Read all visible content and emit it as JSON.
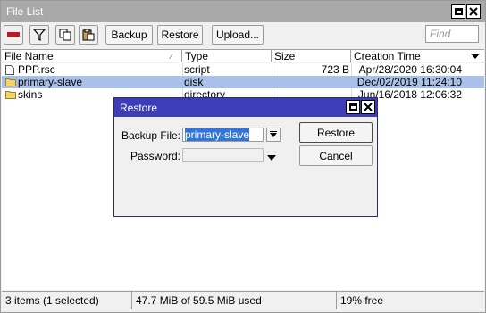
{
  "window": {
    "title": "File List"
  },
  "toolbar": {
    "backup_label": "Backup",
    "restore_label": "Restore",
    "upload_label": "Upload...",
    "find_placeholder": "Find"
  },
  "table": {
    "columns": [
      "File Name",
      "Type",
      "Size",
      "Creation Time"
    ],
    "rows": [
      {
        "name": "PPP.rsc",
        "type": "script",
        "size": "723 B",
        "time": "Apr/28/2020 16:30:04",
        "icon": "file-icon"
      },
      {
        "name": "primary-slave",
        "type": "disk",
        "size": "",
        "time": "Dec/02/2019 11:24:10",
        "icon": "folder-icon"
      },
      {
        "name": "skins",
        "type": "directory",
        "size": "",
        "time": "Jun/16/2018 12:06:32",
        "icon": "folder-icon"
      }
    ],
    "selected_row": 1
  },
  "status": {
    "items": "3 items (1 selected)",
    "usage": "47.7 MiB of 59.5 MiB used",
    "free": "19% free"
  },
  "dialog": {
    "title": "Restore",
    "backup_file_label": "Backup File:",
    "backup_file_value": "primary-slave",
    "password_label": "Password:",
    "password_value": "",
    "restore_label": "Restore",
    "cancel_label": "Cancel"
  },
  "colors": {
    "titlebar": "#a9a9a9",
    "dialog_titlebar": "#3d3dba",
    "selected_row": "#a9c1e8",
    "text_selection": "#3375d6"
  }
}
